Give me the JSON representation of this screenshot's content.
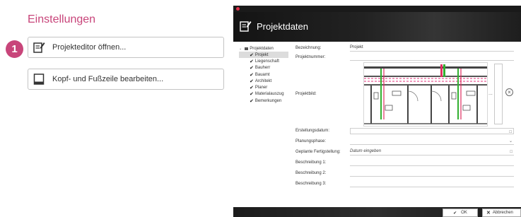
{
  "settings": {
    "title": "Einstellungen",
    "step_number": "1",
    "buttons": [
      {
        "label": "Projekteditor öffnen..."
      },
      {
        "label": "Kopf- und Fußzeile bearbeiten..."
      }
    ]
  },
  "dialog": {
    "title": "Projektdaten",
    "tree": {
      "root": "Projektdaten",
      "items": [
        "Projekt",
        "Liegenschaft",
        "Bauherr",
        "Bauamt",
        "Architekt",
        "Planer",
        "Materialauszug",
        "Bemerkungen"
      ]
    },
    "fields": {
      "bezeichnung_label": "Bezeichnung:",
      "bezeichnung_value": "Projekt",
      "projektnummer_label": "Projektnummer:",
      "projektbild_label": "Projektbild:",
      "erstellungsdatum_label": "Erstellungsdatum:",
      "planungsphase_label": "Planungsphase:",
      "fertigstellung_label": "Geplante Fertigstellung:",
      "fertigstellung_placeholder": "Datum eingeben",
      "beschreibung1_label": "Beschreibung 1:",
      "beschreibung2_label": "Beschreibung 2:",
      "beschreibung3_label": "Beschreibung 3:"
    },
    "image_button": "...",
    "footer": {
      "ok_label": "OK",
      "cancel_label": "Abbrechen"
    }
  }
}
